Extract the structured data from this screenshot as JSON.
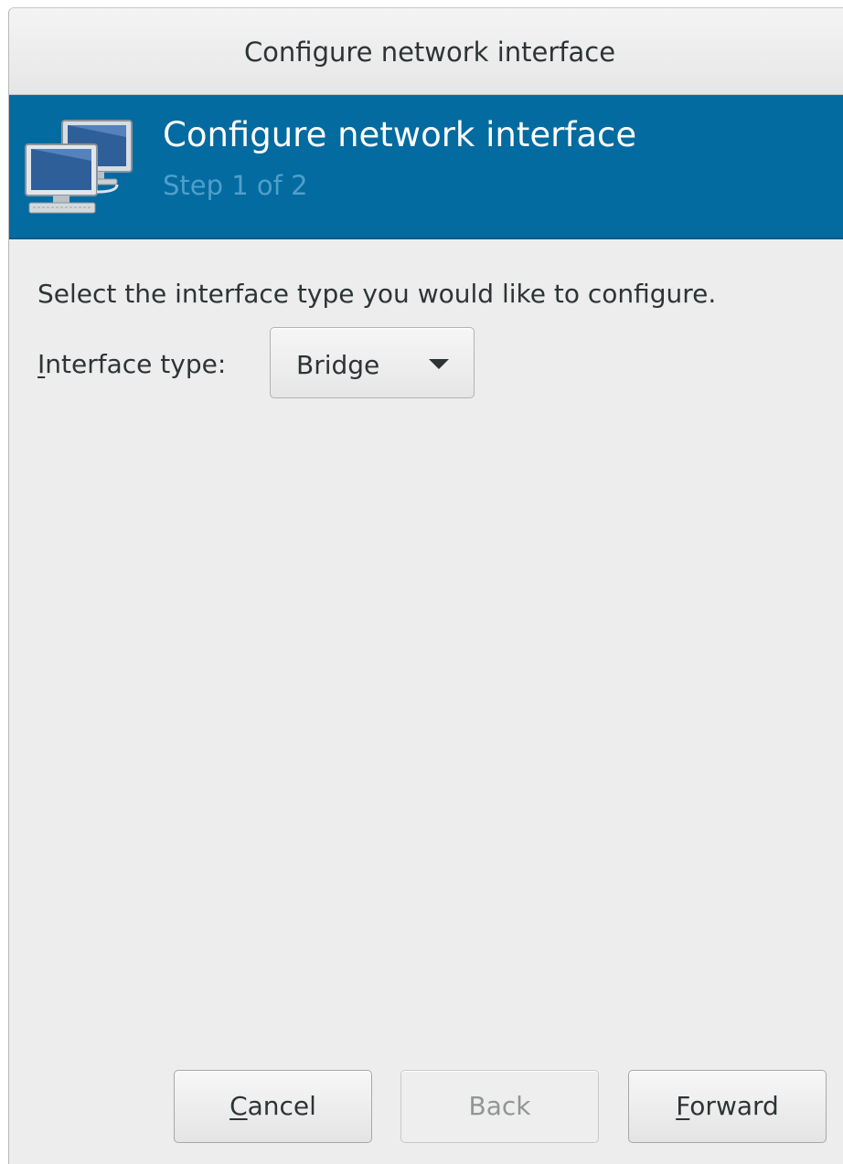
{
  "window": {
    "title": "Configure network interface"
  },
  "banner": {
    "title": "Configure network interface",
    "step": "Step 1 of 2",
    "icon": "network-computers-icon",
    "background_color": "#036ba0"
  },
  "content": {
    "instructions": "Select the interface type you would like to configure.",
    "interface_type": {
      "label_mnemonic": "I",
      "label_rest": "nterface type:",
      "selected": "Bridge"
    }
  },
  "buttons": {
    "cancel": {
      "mnemonic": "C",
      "rest": "ancel"
    },
    "back": {
      "label": "Back",
      "enabled": false
    },
    "forward": {
      "mnemonic": "F",
      "rest": "orward"
    }
  }
}
